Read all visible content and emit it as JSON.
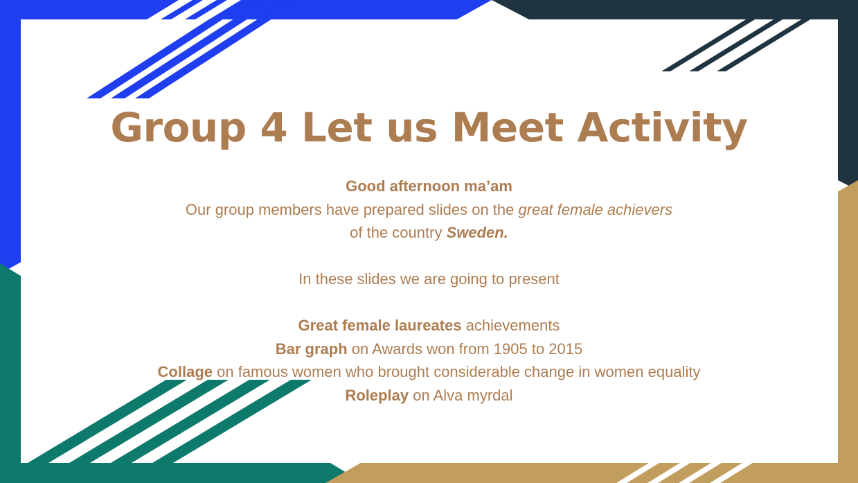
{
  "slide": {
    "title": "Group 4 Let us Meet Activity",
    "greeting": "Good afternoon ma’am",
    "intro_1": "Our group members have prepared slides on the ",
    "intro_emph": "great female achievers",
    "intro_2": "of the country ",
    "country": "Sweden.",
    "present_line": "In these slides we are going to present",
    "items": [
      {
        "bold": "Great female laureates",
        "rest": " achievements"
      },
      {
        "bold": "Bar graph",
        "rest": " on Awards won from 1905 to 2015"
      },
      {
        "bold": "Collage",
        "rest": " on famous women who brought considerable change in women equality"
      },
      {
        "bold": "Roleplay",
        "rest": " on Alva myrdal"
      }
    ]
  },
  "theme": {
    "text_color": "#ad7d52",
    "blue": "#1f3ef0",
    "navy": "#1f3440",
    "teal": "#0e7a6c",
    "gold": "#c19d5e"
  }
}
